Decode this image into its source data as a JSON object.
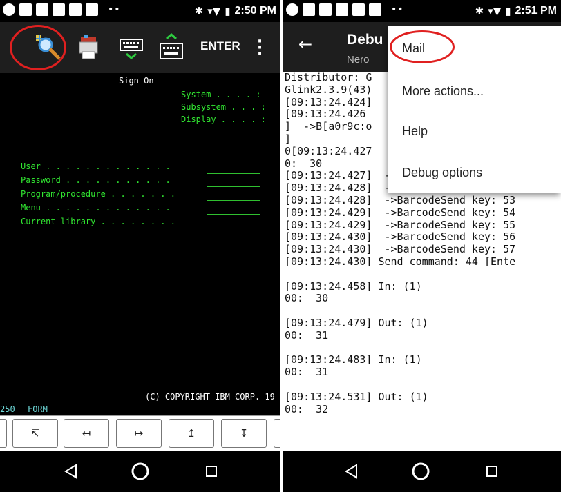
{
  "left": {
    "status_bar": {
      "time": "2:50 PM"
    },
    "toolbar": {
      "enter_label": "ENTER"
    },
    "terminal": {
      "title": "Sign On",
      "system_label": "System . . . . :",
      "subsystem_label": "Subsystem . . . :",
      "display_label": "Display . . . . :",
      "fields": [
        {
          "label": "User . . . . . . . . . . . . ."
        },
        {
          "label": "Password . . . . . . . . . . ."
        },
        {
          "label": "Program/procedure . . . . . . ."
        },
        {
          "label": "Menu . . . . . . . . . . . . ."
        },
        {
          "label": "Current library . . . . . . . ."
        }
      ],
      "copyright": "(C) COPYRIGHT IBM CORP. 19",
      "status_left": "250",
      "status_form": "FORM"
    },
    "keys": [
      "↸",
      "↤",
      "↦",
      "↥",
      "↧"
    ]
  },
  "right": {
    "status_bar": {
      "time": "2:51 PM"
    },
    "appbar": {
      "title": "Debu",
      "subtitle": "Nero"
    },
    "log_lines": [
      "Distributor: G                t",
      "Glink2.3.9(43)                l",
      "[09:13:24.424]                3",
      "[09:13:24.426                 ",
      "]  ->B[a0r9c:o                )",
      "]",
      "0[09:13:24.427                5",
      "0:  30",
      "[09:13:24.427]  ->BarcodeSend key: 51",
      "[09:13:24.428]  ->BarcodeSend key: 52",
      "[09:13:24.428]  ->BarcodeSend key: 53",
      "[09:13:24.429]  ->BarcodeSend key: 54",
      "[09:13:24.429]  ->BarcodeSend key: 55",
      "[09:13:24.430]  ->BarcodeSend key: 56",
      "[09:13:24.430]  ->BarcodeSend key: 57",
      "[09:13:24.430] Send command: 44 [Ente",
      "",
      "[09:13:24.458] In: (1)",
      "00:  30",
      "",
      "[09:13:24.479] Out: (1)",
      "00:  31",
      "",
      "[09:13:24.483] In: (1)",
      "00:  31",
      "",
      "[09:13:24.531] Out: (1)",
      "00:  32"
    ],
    "menu": [
      "Mail",
      "More actions...",
      "Help",
      "Debug options"
    ]
  },
  "colors": {
    "highlight": "#e02020",
    "terminal_green": "#31e631",
    "terminal_cyan": "#6dd7d7"
  }
}
